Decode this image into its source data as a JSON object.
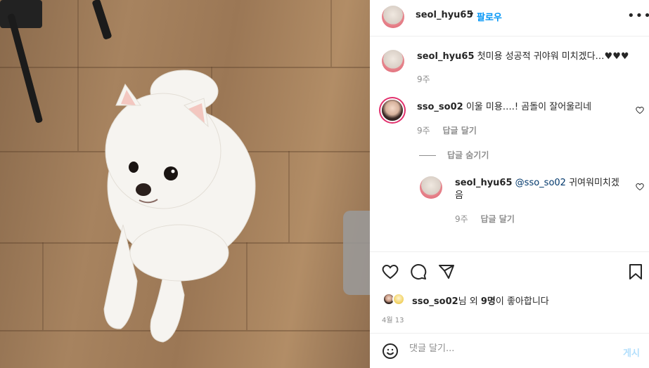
{
  "header": {
    "username": "seol_hyu65",
    "separator": "•",
    "follow_label": "팔로우",
    "more_label": "•••"
  },
  "caption": {
    "username": "seol_hyu65",
    "text": "첫미용 성공적 귀야워 미치겠다…♥♥♥",
    "time": "9주"
  },
  "comments": [
    {
      "username": "sso_so02",
      "text": "이울 미용….! 곰돌이 잘어울리네",
      "time": "9주",
      "reply_label": "답글 달기"
    }
  ],
  "hide_replies_label": "답글 숨기기",
  "reply": {
    "username": "seol_hyu65",
    "mention": "@sso_so02",
    "text_line1": "귀여워미치겠",
    "text_line2": "음",
    "time": "9주",
    "reply_label": "답글 달기"
  },
  "likes": {
    "user": "sso_so02",
    "middle": "님 외 ",
    "count": "9명",
    "suffix": "이 좋아합니다"
  },
  "date": "4월 13",
  "add_comment": {
    "placeholder": "댓글 달기...",
    "post_label": "게시"
  },
  "icons": {
    "heart": "heart-icon",
    "comment": "comment-icon",
    "share": "share-icon",
    "save": "bookmark-icon",
    "emoji": "emoji-icon"
  },
  "colors": {
    "accent": "#0095f6",
    "post_disabled": "#b2dffc"
  }
}
